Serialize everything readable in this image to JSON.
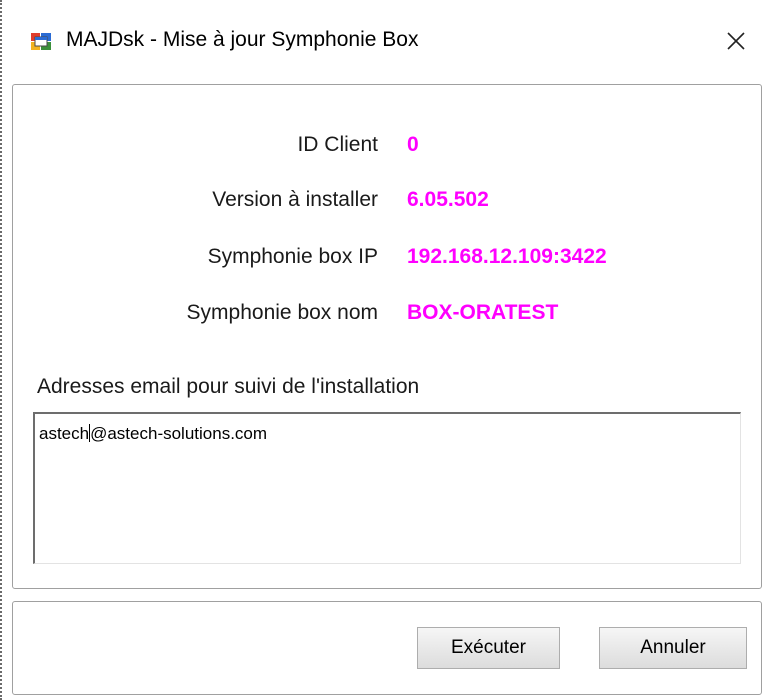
{
  "window": {
    "title": "MAJDsk - Mise à jour Symphonie Box",
    "close_glyph": "✕",
    "app_icon": "app-window-icon"
  },
  "info": {
    "client_id_label": "ID Client",
    "client_id_value": "0",
    "version_label": "Version à installer",
    "version_value": "6.05.502",
    "box_ip_label": "Symphonie box IP",
    "box_ip_value": "192.168.12.109:3422",
    "box_name_label": "Symphonie box nom",
    "box_name_value": "BOX-ORATEST"
  },
  "email": {
    "label": "Adresses email pour suivi de l'installation",
    "value_before_caret": "astech",
    "value_after_caret": "@astech-solutions.com"
  },
  "buttons": {
    "execute_label": "Exécuter",
    "cancel_label": "Annuler"
  },
  "colors": {
    "value_accent": "#ff00ff",
    "border": "#a0a0a0"
  }
}
